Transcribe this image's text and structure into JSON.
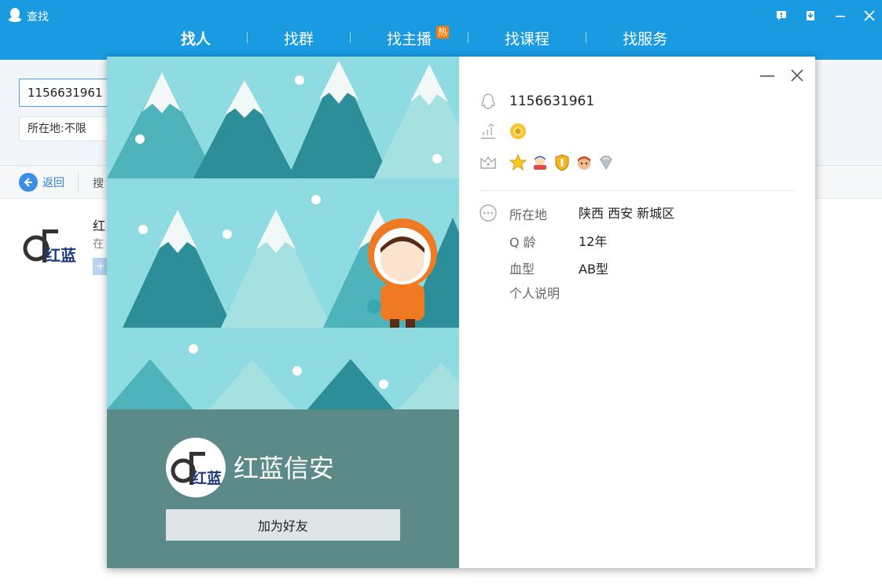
{
  "window": {
    "title": "查找"
  },
  "nav": {
    "items": [
      {
        "label": "找人",
        "active": true
      },
      {
        "label": "找群"
      },
      {
        "label": "找主播",
        "badge": "热"
      },
      {
        "label": "找课程"
      },
      {
        "label": "找服务"
      }
    ]
  },
  "search": {
    "value": "1156631961",
    "location": "所在地:不限"
  },
  "backbar": {
    "back_label": "返回",
    "search_label": "搜"
  },
  "result": {
    "name": "红",
    "sub": "在",
    "add": "+"
  },
  "card": {
    "nickname": "红蓝信安",
    "logo_text": "红蓝",
    "add_friend_label": "加为好友",
    "qq_number": "1156631961",
    "info": [
      {
        "label": "所在地",
        "value": "陕西 西安 新城区"
      },
      {
        "label": "Q 龄",
        "value": "12年"
      },
      {
        "label": "血型",
        "value": "AB型"
      },
      {
        "label": "个人说明",
        "value": ""
      }
    ]
  },
  "colors": {
    "topbar": "#1a9ae0",
    "profile_bg": "#5b8a89",
    "sky": "#8fdbe2",
    "tree_dark": "#2c8e99",
    "tree_mid": "#4fb3bc",
    "tree_light": "#a6e1e1"
  }
}
